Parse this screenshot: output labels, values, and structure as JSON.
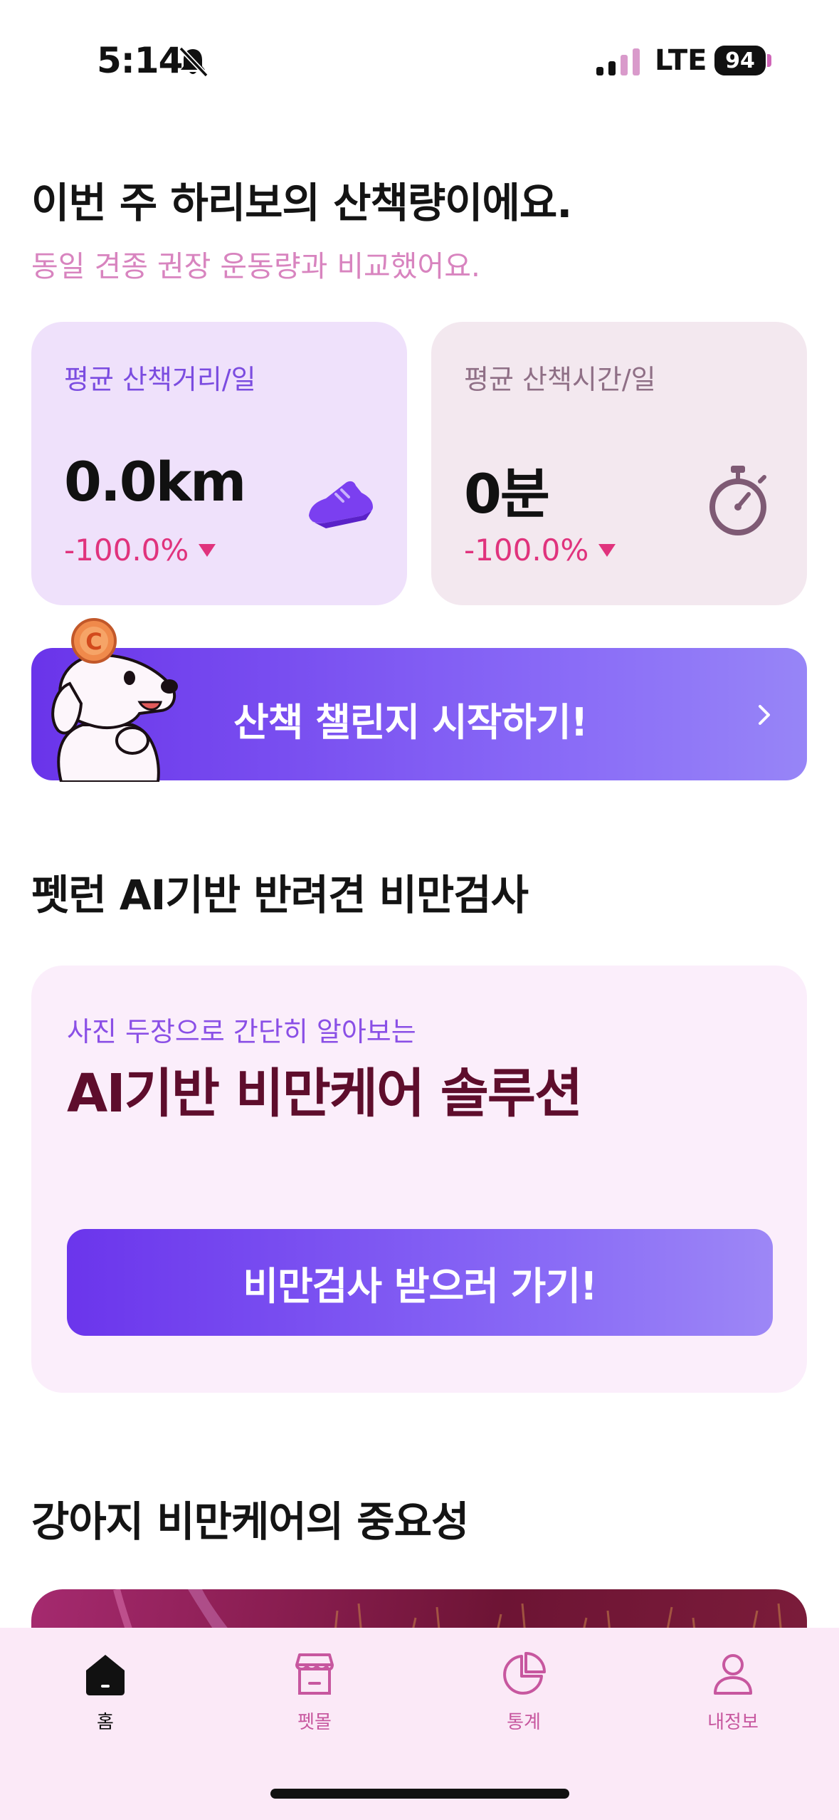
{
  "status_bar": {
    "time": "5:14",
    "network": "LTE",
    "battery": "94"
  },
  "walk_summary": {
    "title": "이번 주 하리보의 산책량이에요.",
    "subtitle": "동일 견종 권장 운동량과 비교했어요.",
    "distance_card": {
      "label": "평균 산책거리/일",
      "value": "0.0km",
      "change": "-100.0%",
      "icon": "shoe-icon"
    },
    "time_card": {
      "label": "평균 산책시간/일",
      "value": "0분",
      "change": "-100.0%",
      "icon": "stopwatch-icon"
    }
  },
  "challenge_banner": {
    "label": "산책 챌린지 시작하기!",
    "coin_letter": "C"
  },
  "ai_section": {
    "title": "펫런 AI기반 반려견 비만검사",
    "card_subtitle": "사진 두장으로 간단히 알아보는",
    "card_title": "AI기반 비만케어 솔루션",
    "button_label": "비만검사 받으러 가기!"
  },
  "importance_section": {
    "title": "강아지 비만케어의 중요성"
  },
  "tabs": [
    {
      "label": "홈",
      "icon": "home-icon",
      "active": true
    },
    {
      "label": "펫몰",
      "icon": "store-icon",
      "active": false
    },
    {
      "label": "통계",
      "icon": "pie-chart-icon",
      "active": false
    },
    {
      "label": "내정보",
      "icon": "person-icon",
      "active": false
    }
  ],
  "colors": {
    "accent_purple": "#6a34ea",
    "negative_change": "#e0337d",
    "subtitle_pink": "#d884bf",
    "ai_title": "#5e0d2c",
    "tab_bar_bg": "#fbe9f7"
  }
}
